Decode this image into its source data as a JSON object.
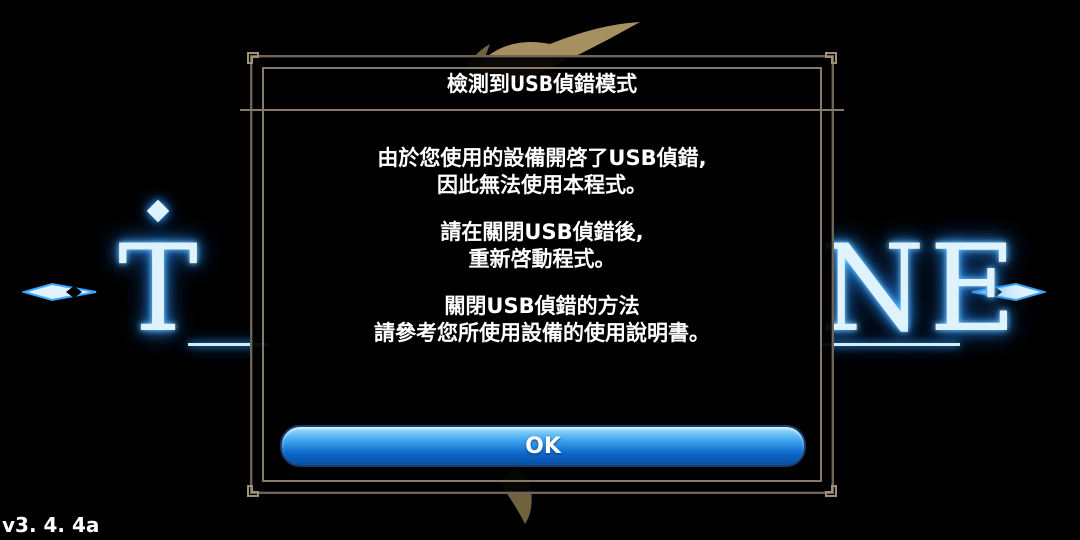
{
  "dialog": {
    "title": "檢測到USB偵錯模式",
    "paragraphs": [
      [
        "由於您使用的設備開啓了USB偵錯,",
        "因此無法使用本程式。"
      ],
      [
        "請在關閉USB偵錯後,",
        "重新啓動程式。"
      ],
      [
        "關閉USB偵錯的方法",
        "請參考您所使用設備的使用說明書。"
      ]
    ],
    "ok_label": "OK"
  },
  "version": "v3. 4. 4a",
  "colors": {
    "glow": "#2e9bff",
    "frame": "#857a6b",
    "button_top": "#9fe0ff",
    "button_bottom": "#0a4fa3",
    "gold": "#b8a06a"
  },
  "icons": {
    "logo": "title-logo",
    "ornament": "corner-ornament-icon",
    "arrow": "side-arrow-icon"
  }
}
